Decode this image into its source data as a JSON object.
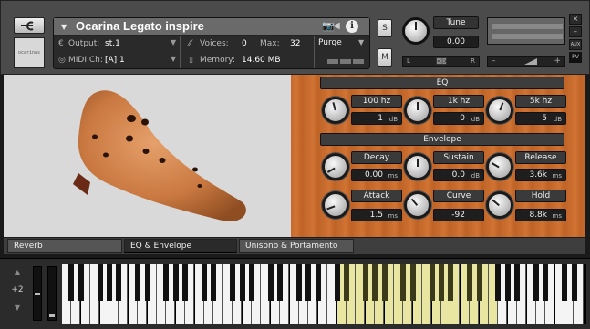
{
  "header": {
    "instrument_name": "Ocarina Legato inspire",
    "output_label": "Output:",
    "output_value": "st.1",
    "midi_label": "MIDI Ch:",
    "midi_value": "[A]  1",
    "voices_label": "Voices:",
    "voices_value": "0",
    "max_label": "Max:",
    "max_value": "32",
    "memory_label": "Memory:",
    "memory_value": "14.60 MB",
    "purge_label": "Purge",
    "solo_label": "S",
    "mute_label": "M",
    "tune_label": "Tune",
    "tune_value": "0.00",
    "pan_left": "L",
    "pan_right": "R",
    "side_close": "×",
    "side_min": "–",
    "side_aux": "AUX",
    "side_pv": "PV",
    "logo_text": "ocarinas",
    "output_icon": "€",
    "midi_icon": "◎",
    "voices_icon": "⁄⁄",
    "memory_icon": "▯"
  },
  "eq": {
    "title": "EQ",
    "bands": [
      {
        "label": "100 hz",
        "value": "1",
        "unit": "dB"
      },
      {
        "label": "1k hz",
        "value": "0",
        "unit": "dB"
      },
      {
        "label": "5k hz",
        "value": "5",
        "unit": "dB"
      }
    ]
  },
  "envelope": {
    "title": "Envelope",
    "params": [
      {
        "label": "Decay",
        "value": "0.00",
        "unit": "ms"
      },
      {
        "label": "Sustain",
        "value": "0.0",
        "unit": "dB"
      },
      {
        "label": "Release",
        "value": "3.6k",
        "unit": "ms"
      },
      {
        "label": "Attack",
        "value": "1.5",
        "unit": "ms"
      },
      {
        "label": "Curve",
        "value": "-92",
        "unit": ""
      },
      {
        "label": "Hold",
        "value": "8.8k",
        "unit": "ms"
      }
    ]
  },
  "tabs": [
    {
      "label": "Reverb",
      "active": false
    },
    {
      "label": "EQ & Envelope",
      "active": true
    },
    {
      "label": "Unisono & Portamento",
      "active": false
    }
  ],
  "keyboard": {
    "octave_value": "+2",
    "highlight_color": "#e8e6a0"
  },
  "colors": {
    "panel_orange": "#c56a2e",
    "header_gray": "#4b4b4b"
  }
}
